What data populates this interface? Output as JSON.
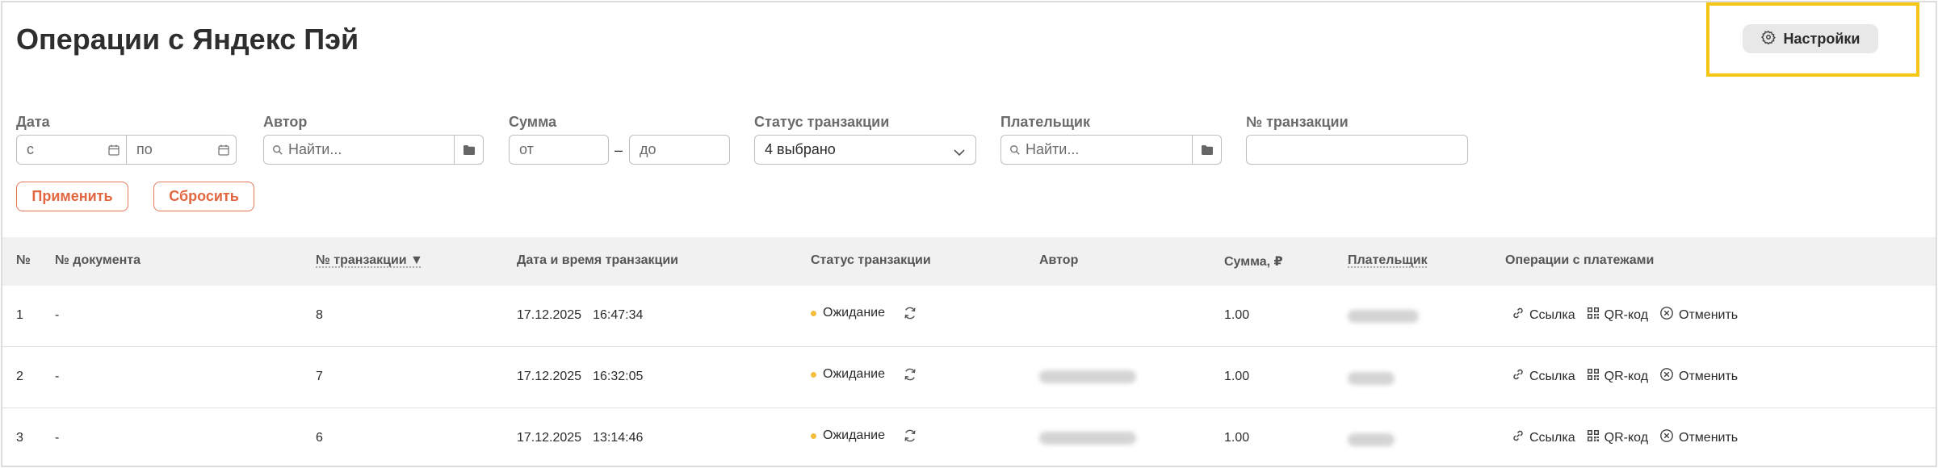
{
  "page": {
    "title": "Операции с Яндекс Пэй"
  },
  "header": {
    "settings_label": "Настройки"
  },
  "filters": {
    "date": {
      "label": "Дата",
      "from_placeholder": "с",
      "to_placeholder": "по"
    },
    "author": {
      "label": "Автор",
      "placeholder": "Найти..."
    },
    "amount": {
      "label": "Сумма",
      "from_placeholder": "от",
      "separator": "–",
      "to_placeholder": "до"
    },
    "status": {
      "label": "Статус транзакции",
      "value": "4 выбрано"
    },
    "payer": {
      "label": "Плательщик",
      "placeholder": "Найти..."
    },
    "transaction_no": {
      "label": "№ транзакции",
      "value": ""
    },
    "apply_label": "Применить",
    "reset_label": "Сбросить"
  },
  "table": {
    "headers": {
      "num": "№",
      "doc": "№ документа",
      "txn": "№ транзакции ▼",
      "datetime": "Дата и время транзакции",
      "status": "Статус транзакции",
      "author": "Автор",
      "sum": "Сумма, ₽",
      "payer": "Плательщик",
      "ops": "Операции с платежами"
    },
    "rows": [
      {
        "num": "1",
        "doc": "-",
        "txn": "8",
        "date": "17.12.2025",
        "time": "16:47:34",
        "status": "Ожидание",
        "sum": "1.00"
      },
      {
        "num": "2",
        "doc": "-",
        "txn": "7",
        "date": "17.12.2025",
        "time": "16:32:05",
        "status": "Ожидание",
        "sum": "1.00"
      },
      {
        "num": "3",
        "doc": "-",
        "txn": "6",
        "date": "17.12.2025",
        "time": "13:14:46",
        "status": "Ожидание",
        "sum": "1.00"
      }
    ],
    "ops": {
      "link": "Ссылка",
      "qr": "QR-код",
      "cancel": "Отменить"
    }
  },
  "colors": {
    "accent": "#e2663f",
    "highlight": "#f5c518",
    "status_pending": "#f4bf3c"
  },
  "icons": [
    "gear-icon",
    "calendar-icon",
    "search-icon",
    "folder-icon",
    "chevron-down-icon",
    "refresh-icon",
    "link-icon",
    "qr-icon",
    "cancel-icon"
  ]
}
